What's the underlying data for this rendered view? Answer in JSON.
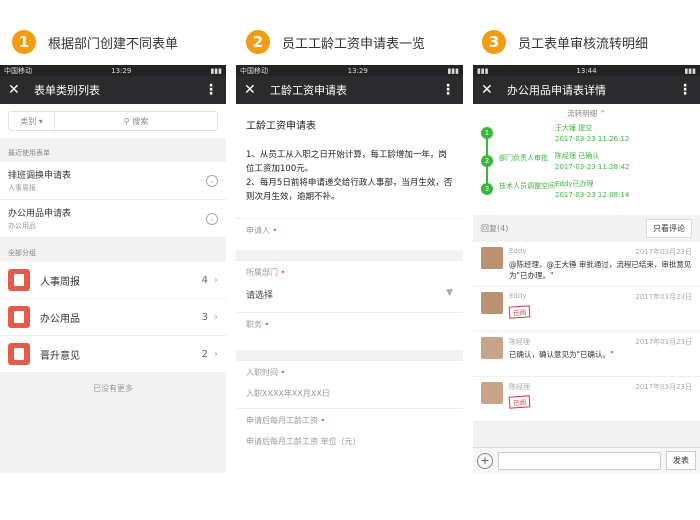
{
  "steps": [
    {
      "num": "1",
      "title": "根据部门创建不同表单"
    },
    {
      "num": "2",
      "title": "员工工龄工资申请表一览"
    },
    {
      "num": "3",
      "title": "员工表单审核流转明细"
    }
  ],
  "p1": {
    "status": {
      "left": "中国移动",
      "time": "13:29"
    },
    "title": "表单类别列表",
    "filter": "类别",
    "search_placeholder": "搜索",
    "recent_label": "最近使用表单",
    "recent": [
      {
        "title": "排班调换申请表",
        "sub": "人事周报"
      },
      {
        "title": "办公用品申请表",
        "sub": "办公用品"
      }
    ],
    "group_label": "全部分组",
    "groups": [
      {
        "label": "人事周报",
        "count": "4"
      },
      {
        "label": "办公用品",
        "count": "3"
      },
      {
        "label": "晋升意见",
        "count": "2"
      }
    ],
    "more": "已没有更多"
  },
  "p2": {
    "status": {
      "left": "中国移动",
      "time": "13:29"
    },
    "title": "工龄工资申请表",
    "form_title": "工龄工资申请表",
    "rule1": "1、从员工从入职之日开始计算，每工龄增加一年，岗位工资加100元。",
    "rule2": "2、每月5日前将申请递交给行政人事部，当月生效，否则次月生效，逾期不补。",
    "f_applicant": "申请人",
    "f_dept": "所属部门",
    "f_dept_val": "请选择",
    "f_post": "职务",
    "f_date": "入职时间",
    "f_date_ph": "入职XXXX年XX月XX日",
    "f_wage": "申请后每月工龄工资",
    "f_wage_ph": "申请后每月工龄工资 单位（元）"
  },
  "p3": {
    "status": {
      "time": "13:44"
    },
    "title": "办公用品申请表详情",
    "track_head": "流转明细",
    "track": [
      {
        "n": "1",
        "label": "",
        "who": "王大锤 提交",
        "time": "2017-03-23 11:26:12"
      },
      {
        "n": "2",
        "label": "部门负责人审批",
        "who": "陈经理 已确认",
        "time": "2017-03-23 11:28:42"
      },
      {
        "n": "3",
        "label": "技术人员调整空间",
        "who": "Eddy已办理",
        "time": "2017-03-23 12:08:14"
      }
    ],
    "reply_label": "回复(4)",
    "reply_btn": "只看评论",
    "comments": [
      {
        "name": "Eddy",
        "date": "2017年03月23日",
        "text": "@陈经理，@王大锤 审批通过，流程已结束，审批意见为\"已办理。\"",
        "stamp": ""
      },
      {
        "name": "Eddy",
        "date": "2017年03月23日",
        "text": "",
        "stamp": "已阅"
      },
      {
        "name": "陈经理",
        "date": "2017年03月23日",
        "text": "已确认，确认意见为\"已确认。\"",
        "stamp": ""
      },
      {
        "name": "陈经理",
        "date": "2017年03月23日",
        "text": "",
        "stamp": "已阅"
      }
    ],
    "send": "发表"
  }
}
